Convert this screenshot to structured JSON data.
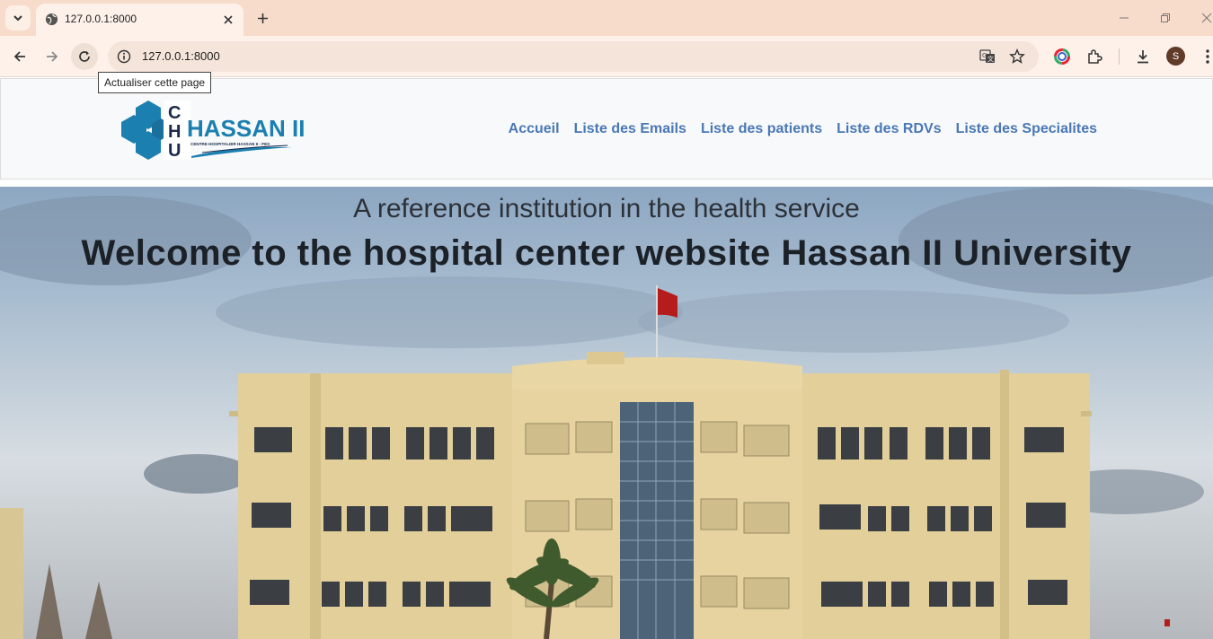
{
  "browser": {
    "tab": {
      "title": "127.0.0.1:8000"
    },
    "address_bar": {
      "url": "127.0.0.1:8000"
    },
    "tooltip": "Actualiser cette page",
    "profile_initial": "S"
  },
  "site": {
    "logo": {
      "letters": "CHU",
      "name": "HASSAN II",
      "tagline": "CENTRE HOSPITALIER HASSAN II - FES"
    },
    "nav": [
      {
        "label": "Accueil"
      },
      {
        "label": "Liste des Emails"
      },
      {
        "label": "Liste des patients"
      },
      {
        "label": "Liste des RDVs"
      },
      {
        "label": "Liste des Specialites"
      }
    ],
    "hero": {
      "subtitle": "A reference institution in the health service",
      "title": "Welcome to the hospital center website Hassan II University"
    }
  },
  "colors": {
    "nav_link": "#4a78b5",
    "logo_blue": "#1b7fb0",
    "tabstrip": "#f8dccb",
    "toolbar": "#fdf1ea"
  }
}
